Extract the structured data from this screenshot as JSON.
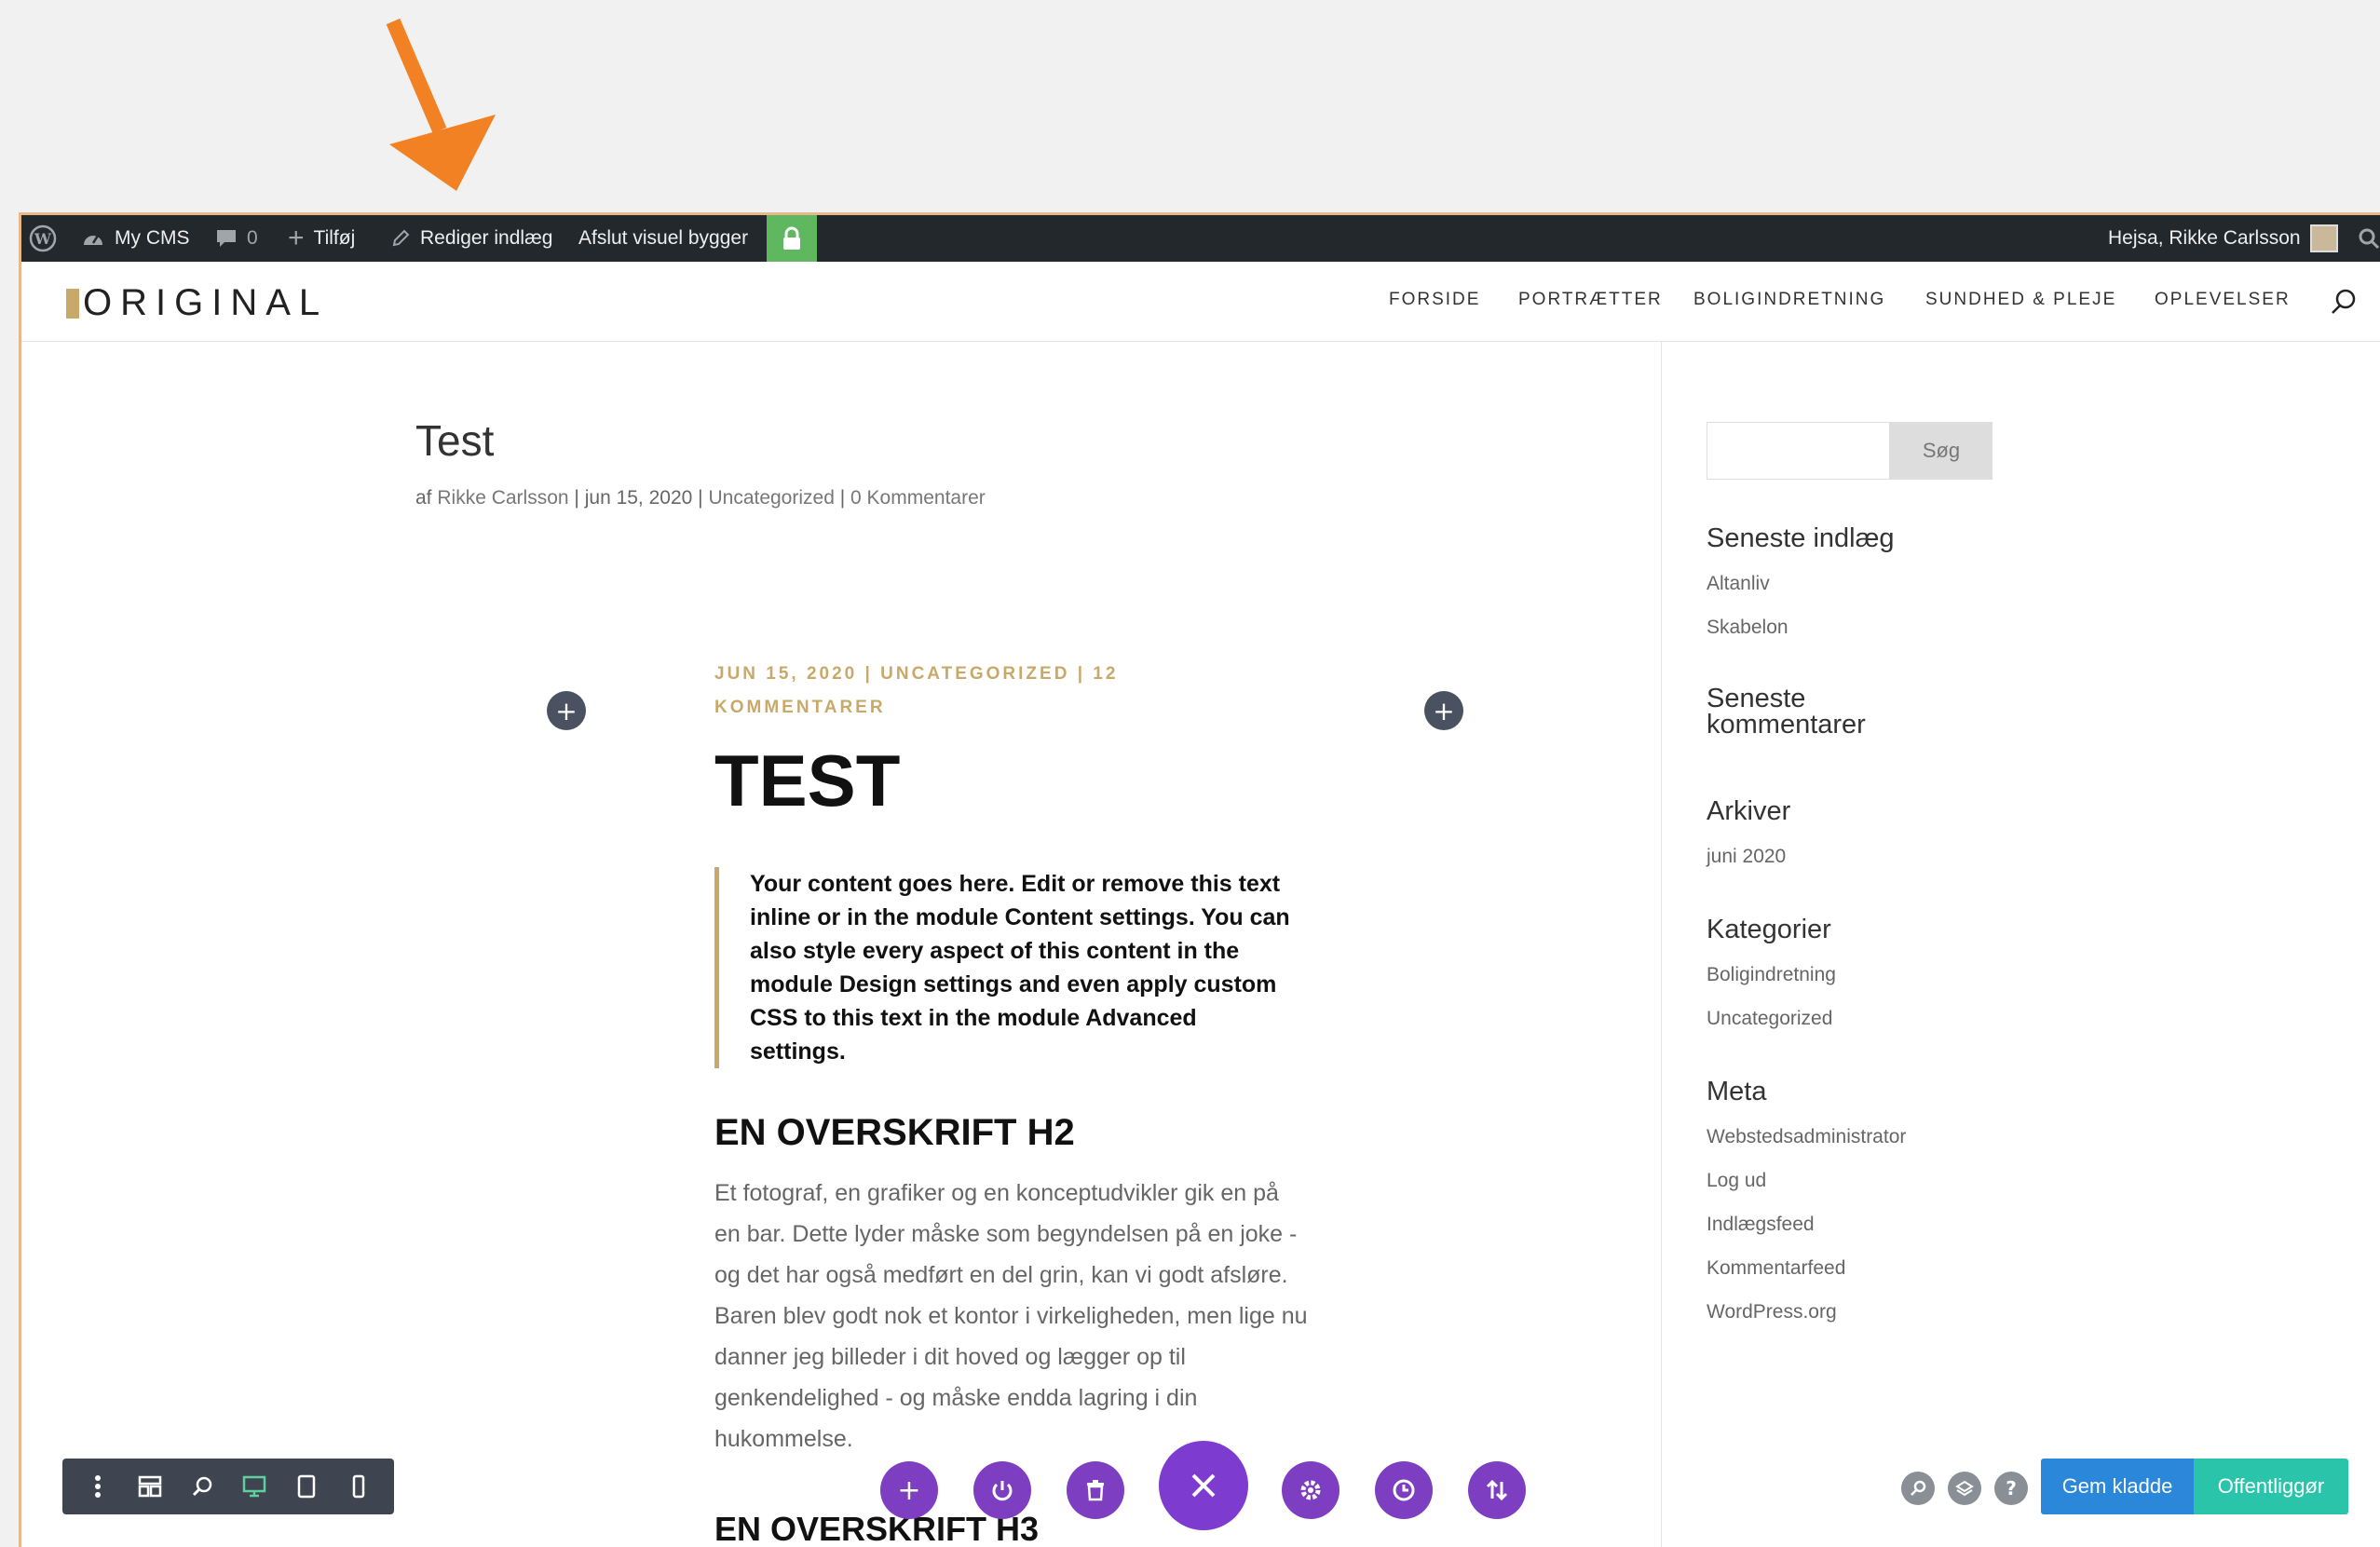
{
  "colors": {
    "arrow": "#f28123",
    "admin_bar": "#23282d",
    "lock_green": "#5fb760",
    "accent_gold": "#c8a96a",
    "builder_purple": "#7d3ec1",
    "draft_blue": "#2b87da",
    "publish_teal": "#29c4a9"
  },
  "admin_bar": {
    "site_name": "My CMS",
    "comments_count": "0",
    "add_label": "Tilføj",
    "edit_label": "Rediger indlæg",
    "exit_builder_label": "Afslut visuel bygger",
    "greeting": "Hejsa, Rikke Carlsson"
  },
  "site": {
    "logo": "ORIGINAL",
    "nav": [
      "FORSIDE",
      "PORTRÆTTER",
      "BOLIGINDRETNING",
      "SUNDHED & PLEJE",
      "OPLEVELSER"
    ]
  },
  "post": {
    "title": "Test",
    "meta_prefix": "af",
    "author": "Rikke Carlsson",
    "date": "jun 15, 2020",
    "category": "Uncategorized",
    "comments": "0 Kommentarer"
  },
  "module": {
    "meta": "JUN 15, 2020 | UNCATEGORIZED | 12 KOMMENTARER",
    "title": "TEST",
    "quote": "Your content goes here. Edit or remove this text inline or in the module Content settings. You can also style every aspect of this content in the module Design settings and even apply custom CSS to this text in the module Advanced settings.",
    "h2": "EN OVERSKRIFT H2",
    "body": "Et fotograf, en grafiker og en konceptudvikler gik en på en bar. Dette lyder måske som begyndelsen på en joke - og det har også medført en del grin, kan vi godt afsløre. Baren blev godt nok et kontor i virkeligheden, men lige nu danner jeg billeder i dit hoved og lægger op til genkendelighed - og måske endda lagring i din hukommelse.",
    "h3": "EN OVERSKRIFT H3"
  },
  "sidebar": {
    "search_button": "Søg",
    "recent_posts_title": "Seneste indlæg",
    "recent_posts": [
      "Altanliv",
      "Skabelon"
    ],
    "recent_comments_title": "Seneste kommentarer",
    "archives_title": "Arkiver",
    "archives": [
      "juni 2020"
    ],
    "categories_title": "Kategorier",
    "categories": [
      "Boligindretning",
      "Uncategorized"
    ],
    "meta_title": "Meta",
    "meta_links": [
      "Webstedsadministrator",
      "Log ud",
      "Indlægsfeed",
      "Kommentarfeed",
      "WordPress.org"
    ]
  },
  "builder": {
    "save_draft": "Gem kladde",
    "publish": "Offentliggør"
  }
}
